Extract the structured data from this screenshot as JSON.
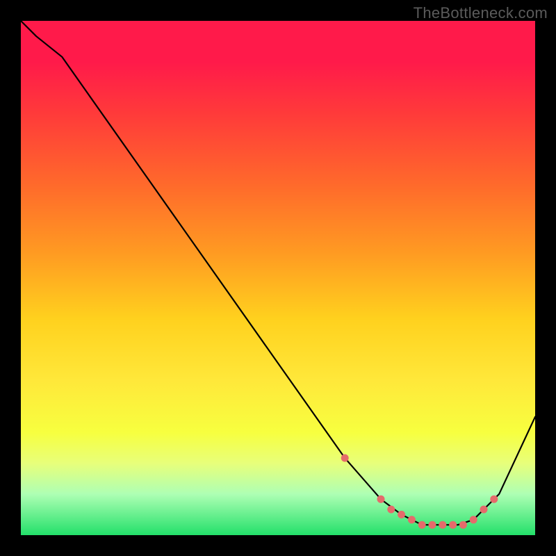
{
  "watermark": "TheBottleneck.com",
  "chart_data": {
    "type": "line",
    "title": "",
    "xlabel": "",
    "ylabel": "",
    "xlim": [
      0,
      100
    ],
    "ylim": [
      0,
      100
    ],
    "series": [
      {
        "name": "curve",
        "x": [
          0,
          3,
          8,
          63,
          70,
          74,
          78,
          82,
          85,
          88,
          90,
          93,
          100
        ],
        "y": [
          100,
          97,
          93,
          15,
          7,
          4,
          2,
          2,
          2,
          3,
          5,
          8,
          23
        ]
      }
    ],
    "markers": {
      "name": "highlight-dots",
      "color": "#e56b6b",
      "x": [
        63,
        70,
        72,
        74,
        76,
        78,
        80,
        82,
        84,
        86,
        88,
        90,
        92
      ],
      "y": [
        15,
        7,
        5,
        4,
        3,
        2,
        2,
        2,
        2,
        2,
        3,
        5,
        7
      ]
    },
    "background_gradient": {
      "top": "#ff1a4a",
      "mid": "#ffd11e",
      "bottom": "#23e06a"
    }
  }
}
